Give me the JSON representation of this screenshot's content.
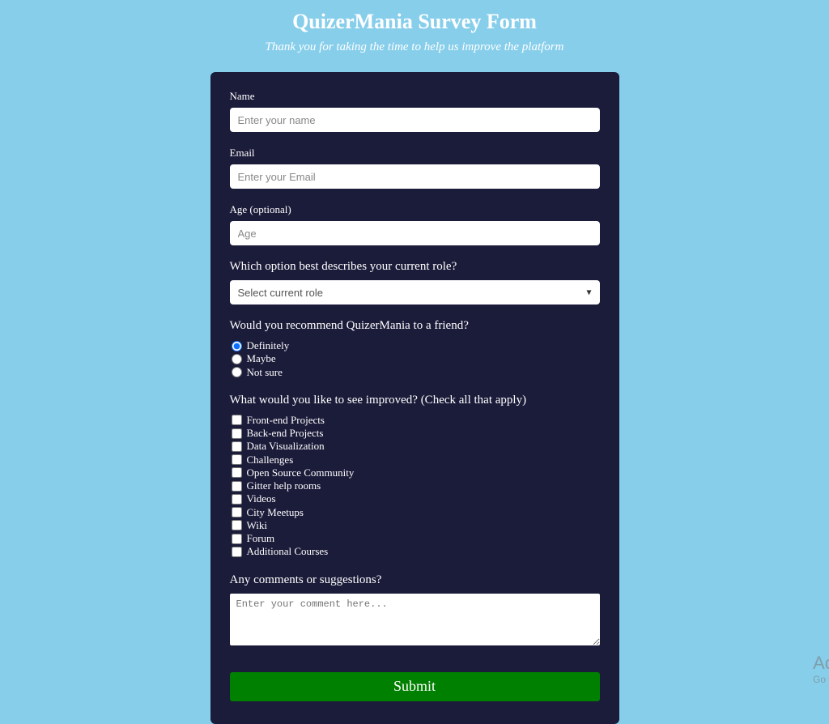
{
  "header": {
    "title": "QuizerMania Survey Form",
    "subtitle": "Thank you for taking the time to help us improve the platform"
  },
  "form": {
    "name": {
      "label": "Name",
      "placeholder": "Enter your name",
      "value": ""
    },
    "email": {
      "label": "Email",
      "placeholder": "Enter your Email",
      "value": ""
    },
    "age": {
      "label": "Age (optional)",
      "placeholder": "Age",
      "value": ""
    },
    "role": {
      "label": "Which option best describes your current role?",
      "selected": "Select current role"
    },
    "recommend": {
      "label": "Would you recommend QuizerMania to a friend?",
      "options": [
        {
          "label": "Definitely",
          "checked": true
        },
        {
          "label": "Maybe",
          "checked": false
        },
        {
          "label": "Not sure",
          "checked": false
        }
      ]
    },
    "improve": {
      "label": "What would you like to see improved? (Check all that apply)",
      "options": [
        "Front-end Projects",
        "Back-end Projects",
        "Data Visualization",
        "Challenges",
        "Open Source Community",
        "Gitter help rooms",
        "Videos",
        "City Meetups",
        "Wiki",
        "Forum",
        "Additional Courses"
      ]
    },
    "comments": {
      "label": "Any comments or suggestions?",
      "placeholder": "Enter your comment here...",
      "value": ""
    },
    "submit_label": "Submit"
  },
  "watermark": {
    "line1": "Activa",
    "line2": "Go to S"
  }
}
